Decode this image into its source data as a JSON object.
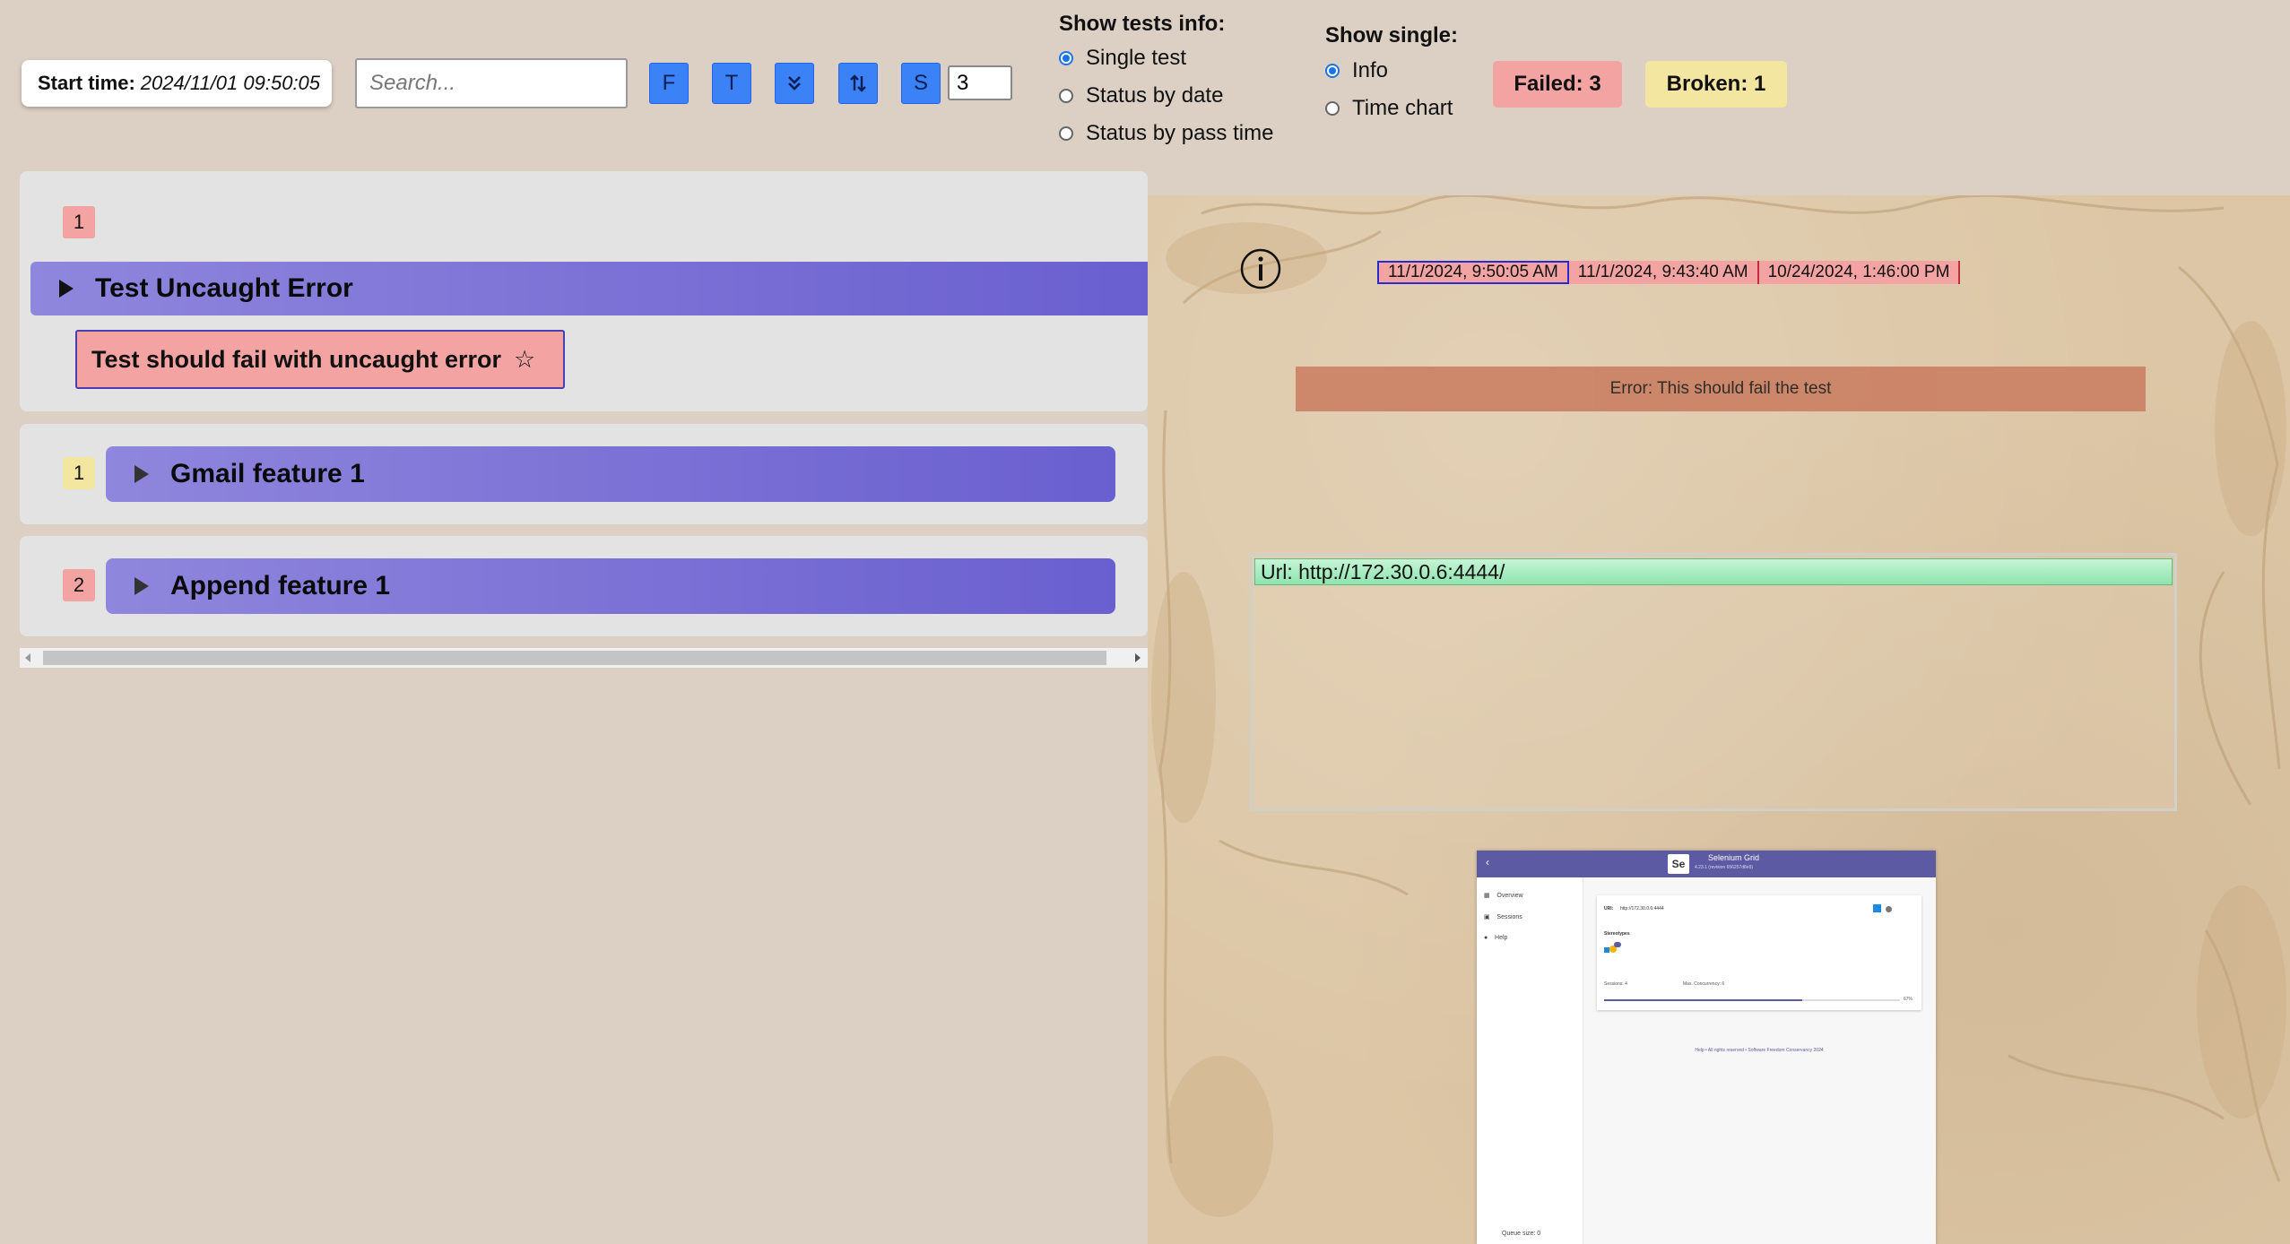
{
  "header": {
    "start_label": "Start time:",
    "start_value": "2024/11/01 09:50:05",
    "search_placeholder": "Search...",
    "buttons": {
      "f": "F",
      "t": "T",
      "s": "S"
    },
    "size_value": "3",
    "show_tests_info": {
      "title": "Show tests info:",
      "options": [
        "Single test",
        "Status by date",
        "Status by pass time"
      ],
      "selected": "Single test"
    },
    "show_single": {
      "title": "Show single:",
      "options": [
        "Info",
        "Time chart"
      ],
      "selected": "Info"
    },
    "failed_label": "Failed: 3",
    "broken_label": "Broken: 1"
  },
  "features": [
    {
      "count": "1",
      "count_color": "#f4a3a3",
      "name": "Test Uncaught Error",
      "expanded": true,
      "tests": [
        {
          "label": "Test should fail with uncaught error",
          "star": "☆"
        }
      ]
    },
    {
      "count": "1",
      "count_color": "#f2e6a0",
      "name": "Gmail feature 1",
      "expanded": false
    },
    {
      "count": "2",
      "count_color": "#f4a3a3",
      "name": "Append feature 1",
      "expanded": false
    }
  ],
  "detail": {
    "icon": "info-icon",
    "dates": [
      "11/1/2024, 9:50:05 AM",
      "11/1/2024, 9:43:40 AM",
      "10/24/2024, 1:46:00 PM"
    ],
    "error": "Error: This should fail the test",
    "url_line": "Url: http://172.30.0.6:4444/"
  },
  "screenshot": {
    "title": "Selenium Grid",
    "version": "4.23.1 (revision 656257d8e9)",
    "menu": [
      "Overview",
      "Sessions",
      "Help"
    ],
    "url_label": "URI:",
    "url_value": "http://172.30.0.6:4444",
    "stereotypes": "Stereotypes",
    "sessions": "Sessions: 4",
    "concurrency": "Max. Concurrency: 6",
    "percent": "67%",
    "progress": 0.67,
    "footer": "Help • All rights reserved • Software Freedom Conservancy 2024",
    "queue": "Queue size: 0"
  },
  "colors": {
    "failed_bg": "#f4a3a3",
    "broken_bg": "#f2e6a0",
    "test_bg": "#f4a3a3",
    "error_bg": "#c97a5e",
    "url_bar": "#9be8b8",
    "date_active_border": "#2a2ad0",
    "date_border": "#c0303a",
    "button_blue": "#3b82f6",
    "feature_bar": "#7a70d6"
  }
}
